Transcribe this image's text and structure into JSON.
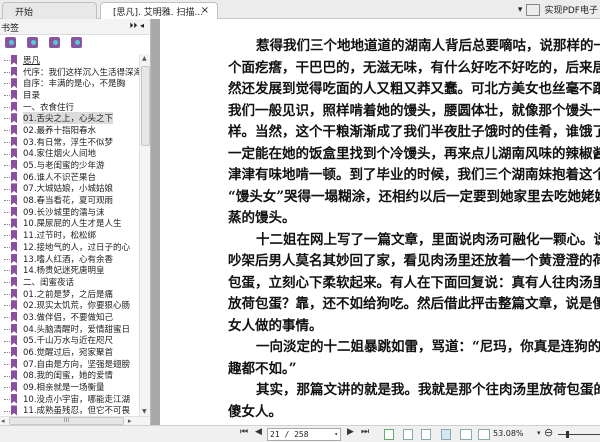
{
  "tabs": [
    {
      "label": "开始"
    },
    {
      "label": "[思凡]. 艾明雅. 扫描...",
      "close": "×"
    }
  ],
  "header_right": {
    "dropdown": "▾",
    "label": "实现PDF电子"
  },
  "sidebar": {
    "title": "书签",
    "controls": "⏵⏵ ◂",
    "items": [
      {
        "label": "思凡"
      },
      {
        "label": "代序：我们这样沉入生活得深海"
      },
      {
        "label": "自序：丰满的是心，不是胸"
      },
      {
        "label": "目录"
      },
      {
        "label": "一、衣食住行"
      },
      {
        "label": "01.舌尖之上，心头之下"
      },
      {
        "label": "02.最养十指阳春水"
      },
      {
        "label": "03.有日常，浮生不似梦"
      },
      {
        "label": "04.家住烟火人间地"
      },
      {
        "label": "05.与老闺蜜的少年游"
      },
      {
        "label": "06.谁人不识芒果台"
      },
      {
        "label": "07.大城姑娘，小城姑娘"
      },
      {
        "label": "08.春当看花，夏可观雨"
      },
      {
        "label": "09.长沙城里的濡与沫"
      },
      {
        "label": "10.屎尿屁的人生才是人生"
      },
      {
        "label": "11.过节时，松松绑"
      },
      {
        "label": "12.接地气的人，过日子的心"
      },
      {
        "label": "13.嗜人红酒，心有余香"
      },
      {
        "label": "14.杨贵妃迷死唐明皇"
      },
      {
        "label": "二、闺蜜夜话"
      },
      {
        "label": "01.之前是梦，之后是痛"
      },
      {
        "label": "02.现实太饥荒，你要狠心肠"
      },
      {
        "label": "03.做伴侣，不要做知己"
      },
      {
        "label": "04.头脑清醒时，爱情甜蜜日"
      },
      {
        "label": "05.千山万水与近在咫尺"
      },
      {
        "label": "06.觉醒过后，宛家聚首"
      },
      {
        "label": "07.自由是方向，坚强是翅膀"
      },
      {
        "label": "08.我的闺蜜，她的爱情"
      },
      {
        "label": "09.相亲就是一场衡量"
      },
      {
        "label": "10.没点小宇宙，哪能走江湖"
      },
      {
        "label": "11.成熟虽残忍，但它不可畏"
      }
    ],
    "selected_index": 5,
    "hscroll_grip": "III"
  },
  "document": {
    "lines": [
      {
        "t": "惹得我们三个地地道道的湖南人背后总要嘀咕，说那样的一",
        "s": "full ind"
      },
      {
        "t": "个面疙瘩，干巴巴的，无滋无味，有什么好吃不好吃的，后来居",
        "s": "full"
      },
      {
        "t": "然还发展到觉得吃面的人又粗又莽又蠢。可北方美女也丝毫不跟",
        "s": "full"
      },
      {
        "t": "我们一般见识，照样啃着她的馒头，腰圆体壮，就像那个馒头一",
        "s": "full"
      },
      {
        "t": "样。当然，这个干粮渐渐成了我们半夜肚子饿时的佳肴，谁饿了，",
        "s": "full"
      },
      {
        "t": "一定能在她的饭盒里找到个冷馒头，再来点儿湖南风味的辣椒酱，",
        "s": "full"
      },
      {
        "t": "津津有味地啃一顿。到了毕业的时候，我们三个湖南妹抱着这个",
        "s": "full"
      },
      {
        "t": "“馒头女”哭得一塌糊涂，还相约以后一定要到她家里去吃她姥姥",
        "s": "full"
      },
      {
        "t": "蒸的馒头。",
        "s": ""
      },
      {
        "t": "十二姐在网上写了一篇文章，里面说肉汤可融化一颗心。说",
        "s": "full ind"
      },
      {
        "t": "吵架后男人莫名其妙回了家，看见肉汤里还放着一个黄澄澄的荷",
        "s": "full"
      },
      {
        "t": "包蛋，立刻心下柔软起来。有人在下面回复说：真有人往肉汤里",
        "s": "full"
      },
      {
        "t": "放荷包蛋？靠，还不如给狗吃。然后借此抨击整篇文章，说是傻",
        "s": "full"
      },
      {
        "t": "女人做的事情。",
        "s": ""
      },
      {
        "t": "一向淡定的十二姐暴跳如雷，骂道：“尼玛，你真是连狗的情",
        "s": "full ind"
      },
      {
        "t": "趣都不如。”",
        "s": ""
      },
      {
        "t": "其实，那篇文讲的就是我。我就是那个往肉汤里放荷包蛋的",
        "s": "full ind"
      },
      {
        "t": "傻女人。",
        "s": ""
      }
    ]
  },
  "toolbar": {
    "first": "⏮",
    "prev": "◀",
    "page_value": "21 / 258",
    "page_dd": "▾",
    "next": "▶",
    "last": "⏭",
    "zoom": "53.08%",
    "zoom_dd": "▾",
    "zoom_out": "⊖"
  }
}
